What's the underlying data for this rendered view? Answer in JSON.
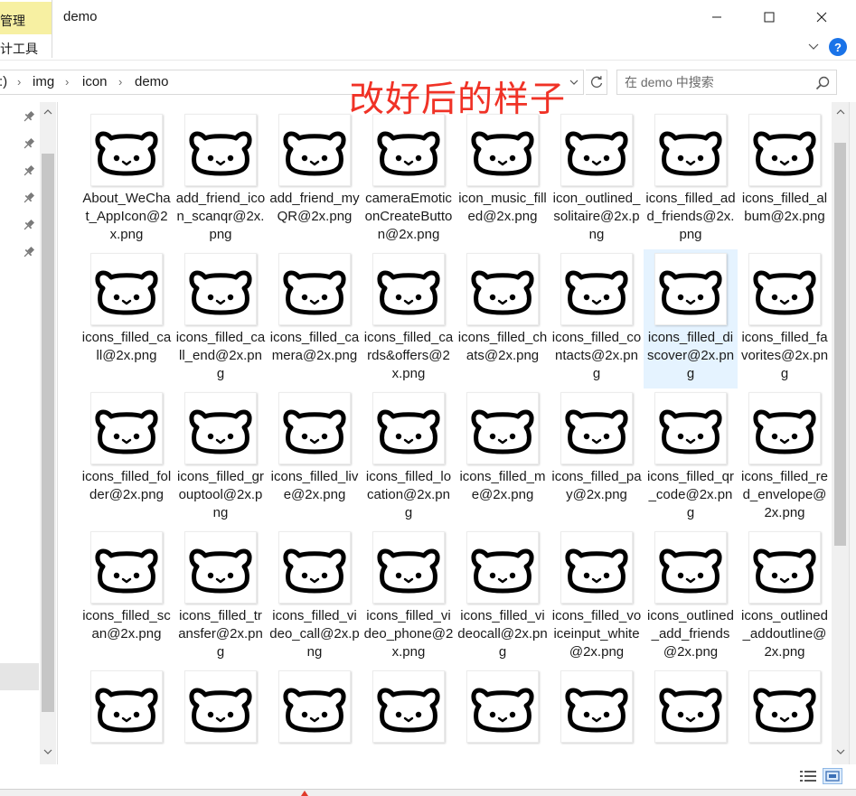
{
  "window": {
    "title": "demo",
    "ribbon_tab_top": "管理",
    "ribbon_tab_bottom": "计工具",
    "help_label": "?"
  },
  "address": {
    "crumbs": [
      ":)",
      "img",
      "icon",
      "demo"
    ]
  },
  "search": {
    "placeholder": "在 demo 中搜索"
  },
  "annotation": {
    "text": "改好后的样子"
  },
  "files": [
    {
      "name": "About_WeChat_AppIcon@2x.png"
    },
    {
      "name": "add_friend_icon_scanqr@2x.png"
    },
    {
      "name": "add_friend_myQR@2x.png"
    },
    {
      "name": "cameraEmoticonCreateButton@2x.png"
    },
    {
      "name": "icon_music_filled@2x.png"
    },
    {
      "name": "icon_outlined_solitaire@2x.png"
    },
    {
      "name": "icons_filled_add_friends@2x.png"
    },
    {
      "name": "icons_filled_album@2x.png"
    },
    {
      "name": "icons_filled_call@2x.png"
    },
    {
      "name": "icons_filled_call_end@2x.png"
    },
    {
      "name": "icons_filled_camera@2x.png"
    },
    {
      "name": "icons_filled_cards&offers@2x.png"
    },
    {
      "name": "icons_filled_chats@2x.png"
    },
    {
      "name": "icons_filled_contacts@2x.png"
    },
    {
      "name": "icons_filled_discover@2x.png",
      "selected": true
    },
    {
      "name": "icons_filled_favorites@2x.png"
    },
    {
      "name": "icons_filled_folder@2x.png"
    },
    {
      "name": "icons_filled_grouptool@2x.png"
    },
    {
      "name": "icons_filled_live@2x.png"
    },
    {
      "name": "icons_filled_location@2x.png"
    },
    {
      "name": "icons_filled_me@2x.png"
    },
    {
      "name": "icons_filled_pay@2x.png"
    },
    {
      "name": "icons_filled_qr_code@2x.png"
    },
    {
      "name": "icons_filled_red_envelope@2x.png"
    },
    {
      "name": "icons_filled_scan@2x.png"
    },
    {
      "name": "icons_filled_transfer@2x.png"
    },
    {
      "name": "icons_filled_video_call@2x.png"
    },
    {
      "name": "icons_filled_video_phone@2x.png"
    },
    {
      "name": "icons_filled_videocall@2x.png"
    },
    {
      "name": "icons_filled_voiceinput_white@2x.png"
    },
    {
      "name": "icons_outlined_add_friends@2x.png"
    },
    {
      "name": "icons_outlined_addoutline@2x.png"
    },
    {
      "name": ""
    },
    {
      "name": ""
    },
    {
      "name": ""
    },
    {
      "name": ""
    },
    {
      "name": ""
    },
    {
      "name": ""
    },
    {
      "name": ""
    },
    {
      "name": ""
    }
  ],
  "colors": {
    "annotation": "#f03226",
    "selection": "#e5f3ff",
    "ribbon_highlight": "#f7f0a2",
    "help_blue": "#1a73e8"
  },
  "icons": {
    "thumbnail": "bear-face-icon",
    "pin": "pin-icon",
    "search": "search-icon",
    "refresh": "refresh-icon"
  }
}
